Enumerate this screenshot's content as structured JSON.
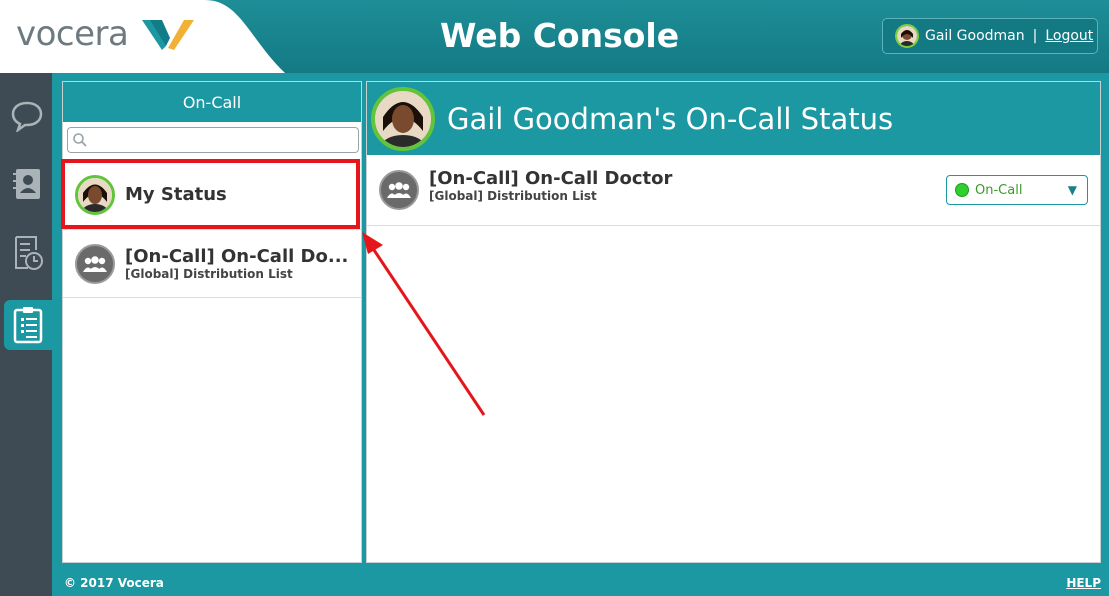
{
  "header": {
    "logo_text": "vocera",
    "title": "Web Console",
    "user_name": "Gail Goodman",
    "separator": "|",
    "logout_label": "Logout"
  },
  "rail": {
    "items": [
      {
        "icon": "chat-icon"
      },
      {
        "icon": "contacts-icon"
      },
      {
        "icon": "history-icon"
      },
      {
        "icon": "clipboard-icon"
      }
    ]
  },
  "left_panel": {
    "title": "On-Call",
    "search_placeholder": "",
    "items": [
      {
        "name": "My Status",
        "sub": ""
      },
      {
        "name": "[On-Call] On-Call Do...",
        "sub": "[Global] Distribution List"
      }
    ]
  },
  "right_panel": {
    "title": "Gail Goodman's On-Call Status",
    "row": {
      "name": "[On-Call] On-Call Doctor",
      "sub": "[Global] Distribution List",
      "status": "On-Call"
    }
  },
  "footer": {
    "copyright": "© 2017 Vocera",
    "help": "HELP"
  },
  "colors": {
    "teal": "#1b98a1",
    "rail": "#3e4a54",
    "highlight": "#e6141b",
    "status_green": "#2fcf2f"
  }
}
